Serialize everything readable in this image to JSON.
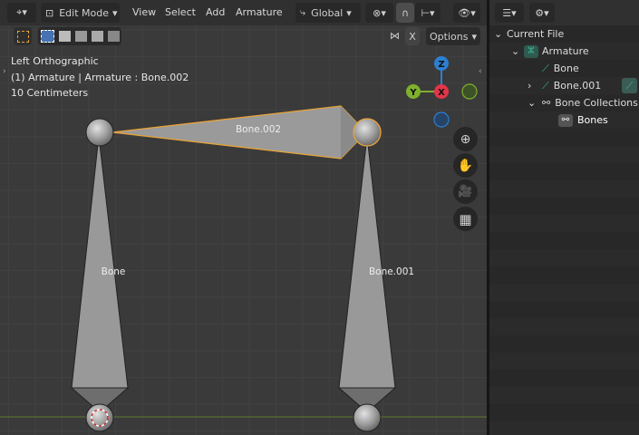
{
  "header": {
    "mode_label": "Edit Mode",
    "menu": [
      "View",
      "Select",
      "Add",
      "Armature"
    ],
    "orientation_label": "Global",
    "options_label": "Options",
    "x_label": "X"
  },
  "overlay": {
    "view_name": "Left Orthographic",
    "context": "(1) Armature | Armature : Bone.002",
    "scale": "10 Centimeters"
  },
  "gizmo": {
    "z": "Z",
    "y": "Y",
    "x": "X"
  },
  "bones": [
    {
      "label": "Bone.002"
    },
    {
      "label": "Bone"
    },
    {
      "label": "Bone.001"
    }
  ],
  "outliner": {
    "items": [
      {
        "label": "Current File"
      },
      {
        "label": "Armature"
      },
      {
        "label": "Bone"
      },
      {
        "label": "Bone.001"
      },
      {
        "label": "Bone Collections"
      },
      {
        "label": "Bones"
      }
    ]
  },
  "colors": {
    "selected_outline": "#e8a33a",
    "bone_fill": "#999999",
    "x_axis": "#e2354a",
    "y_axis": "#7fb02d",
    "z_axis": "#2d7fd0",
    "outliner_icon": "#36b79a"
  }
}
